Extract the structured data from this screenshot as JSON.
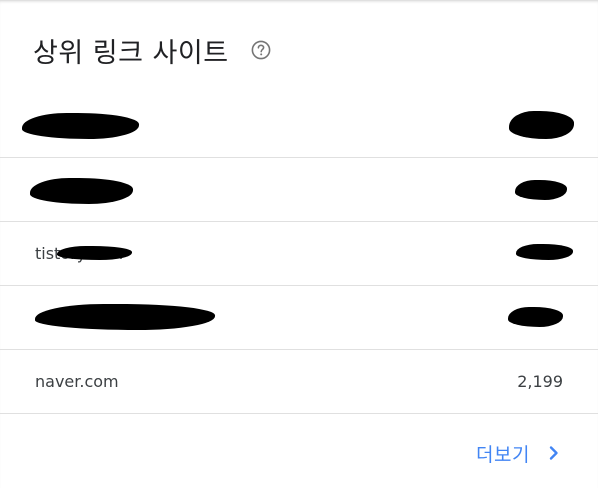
{
  "header": {
    "title": "상위 링크 사이트",
    "help_icon": "help-circle-icon"
  },
  "rows": [
    {
      "site": "",
      "count": "",
      "redacted": true
    },
    {
      "site": "",
      "count": "",
      "redacted": true
    },
    {
      "site": "tistory.com",
      "count": "",
      "redacted": "partial"
    },
    {
      "site": "",
      "count": "",
      "redacted": true
    },
    {
      "site": "naver.com",
      "count": "2,199",
      "redacted": false
    }
  ],
  "footer": {
    "more_label": "더보기",
    "chevron_icon": "chevron-right-icon"
  },
  "colors": {
    "accent": "#4285f4",
    "text": "#202124",
    "muted": "#3c4043",
    "divider": "#e0e0e0",
    "icon_gray": "#757575"
  }
}
